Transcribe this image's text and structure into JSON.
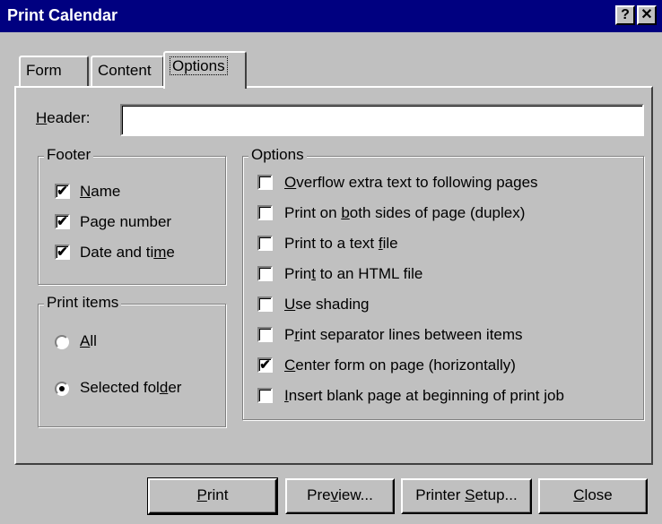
{
  "window": {
    "title": "Print Calendar",
    "help_button": "?",
    "close_button": "✕"
  },
  "tabs": [
    {
      "label": "Form"
    },
    {
      "label": "Content"
    },
    {
      "label": "Options"
    }
  ],
  "header": {
    "label_pre": "",
    "label_ul": "H",
    "label_post": "eader:",
    "value": ""
  },
  "footer_group": {
    "title": "Footer",
    "items": [
      {
        "pre": "",
        "ul": "N",
        "post": "ame",
        "checked": "✔"
      },
      {
        "pre": "Pa",
        "ul": "g",
        "post": "e number",
        "checked": "✔"
      },
      {
        "pre": "Date and ti",
        "ul": "m",
        "post": "e",
        "checked": "✔"
      }
    ]
  },
  "print_items_group": {
    "title": "Print items",
    "items": [
      {
        "pre": "",
        "ul": "A",
        "post": "ll",
        "selected": false
      },
      {
        "pre": "Selected fol",
        "ul": "d",
        "post": "er",
        "selected": true
      }
    ]
  },
  "options_group": {
    "title": "Options",
    "items": [
      {
        "pre": "",
        "ul": "O",
        "post": "verflow extra text to following pages",
        "checked": ""
      },
      {
        "pre": "Print on ",
        "ul": "b",
        "post": "oth sides of page (duplex)",
        "checked": ""
      },
      {
        "pre": "Print to a text ",
        "ul": "f",
        "post": "ile",
        "checked": ""
      },
      {
        "pre": "Prin",
        "ul": "t",
        "post": " to an HTML file",
        "checked": ""
      },
      {
        "pre": "",
        "ul": "U",
        "post": "se shading",
        "checked": ""
      },
      {
        "pre": "P",
        "ul": "r",
        "post": "int separator lines between items",
        "checked": ""
      },
      {
        "pre": "",
        "ul": "C",
        "post": "enter form on page (horizontally)",
        "checked": "✔"
      },
      {
        "pre": "",
        "ul": "I",
        "post": "nsert blank page at beginning of print job",
        "checked": ""
      }
    ]
  },
  "buttons": {
    "print": {
      "pre": "",
      "ul": "P",
      "post": "rint"
    },
    "preview": {
      "pre": "Pre",
      "ul": "v",
      "post": "iew..."
    },
    "setup": {
      "pre": "Printer ",
      "ul": "S",
      "post": "etup..."
    },
    "close": {
      "pre": "",
      "ul": "C",
      "post": "lose"
    }
  }
}
